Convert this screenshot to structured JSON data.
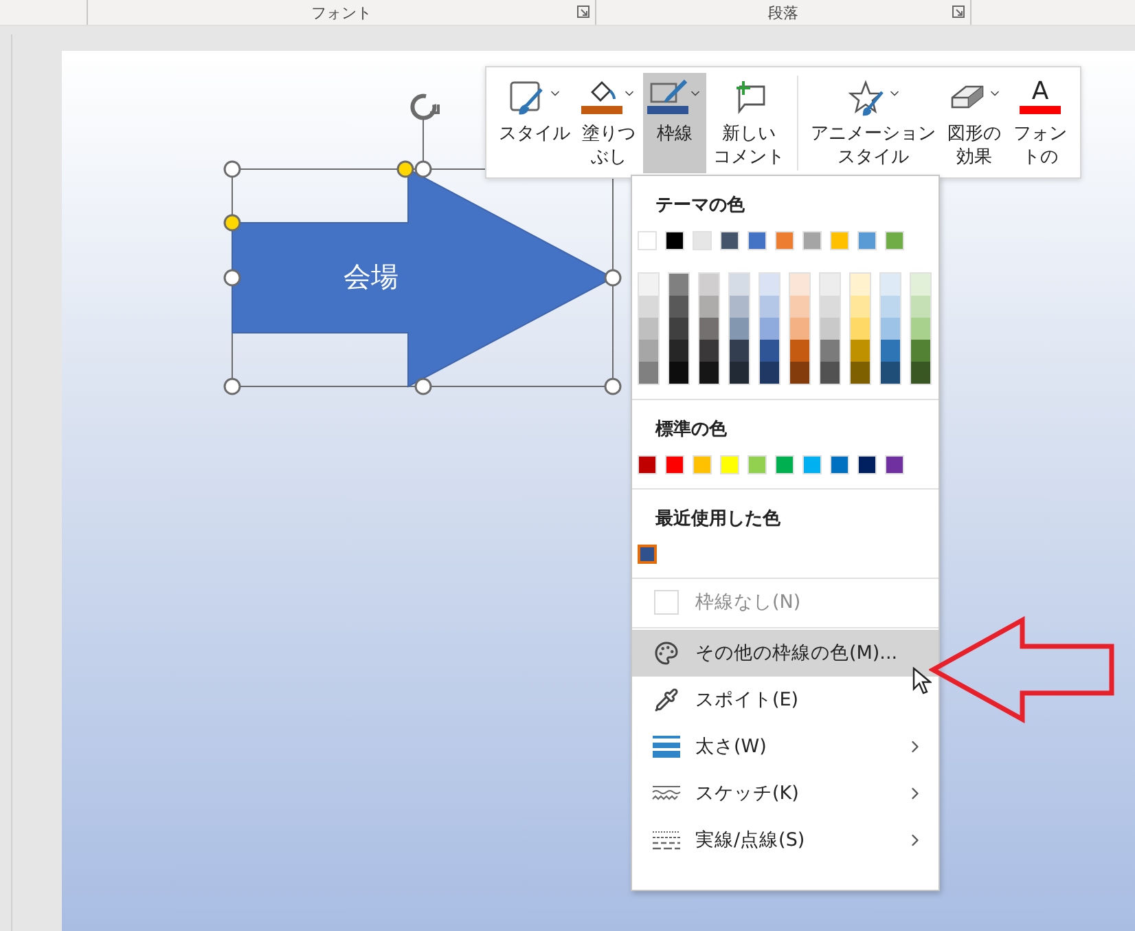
{
  "ribbon": {
    "groups": [
      {
        "label": "フォント"
      },
      {
        "label": "段落"
      }
    ]
  },
  "slide": {
    "shape": {
      "text": "会場"
    }
  },
  "mini_toolbar": {
    "buttons": [
      {
        "kind": "style",
        "lines": [
          "スタイル"
        ],
        "dropdown": true,
        "selected": false
      },
      {
        "kind": "fill",
        "lines": [
          "塗りつ",
          "ぶし"
        ],
        "dropdown": true,
        "selected": false,
        "color": "#c55a11"
      },
      {
        "kind": "outline",
        "lines": [
          "枠線"
        ],
        "dropdown": true,
        "selected": true,
        "color": "#2f5597"
      },
      {
        "kind": "comment",
        "lines": [
          "新しい",
          "コメント"
        ],
        "dropdown": false,
        "selected": false
      },
      {
        "kind": "animation",
        "lines": [
          "アニメーション",
          "スタイル"
        ],
        "dropdown": true,
        "selected": false
      },
      {
        "kind": "effects",
        "lines": [
          "図形の",
          "効果"
        ],
        "dropdown": true,
        "selected": false
      },
      {
        "kind": "font-color",
        "glyph": "A",
        "lines": [
          "フォン",
          "トの"
        ],
        "dropdown": false,
        "selected": false,
        "color": "#ff0000"
      }
    ]
  },
  "menu": {
    "theme_colors": {
      "heading": "テーマの色",
      "top": [
        {
          "color": "#ffffff"
        },
        {
          "color": "#000000"
        },
        {
          "color": "#e7e6e6"
        },
        {
          "color": "#44546a"
        },
        {
          "color": "#4472c4"
        },
        {
          "color": "#ed7d31"
        },
        {
          "color": "#a5a5a5"
        },
        {
          "color": "#ffc000"
        },
        {
          "color": "#5b9bd5"
        },
        {
          "color": "#70ad47"
        }
      ],
      "shades": [
        [
          {
            "color": "#f2f2f2"
          },
          {
            "color": "#d9d9d9"
          },
          {
            "color": "#bfbfbf"
          },
          {
            "color": "#a6a6a6"
          },
          {
            "color": "#808080"
          }
        ],
        [
          {
            "color": "#808080"
          },
          {
            "color": "#595959"
          },
          {
            "color": "#404040"
          },
          {
            "color": "#262626"
          },
          {
            "color": "#0d0d0d"
          }
        ],
        [
          {
            "color": "#d0cece"
          },
          {
            "color": "#aeabab"
          },
          {
            "color": "#757070"
          },
          {
            "color": "#3a3838"
          },
          {
            "color": "#171616"
          }
        ],
        [
          {
            "color": "#d6dce5"
          },
          {
            "color": "#adb9ca"
          },
          {
            "color": "#8497b0"
          },
          {
            "color": "#333f50"
          },
          {
            "color": "#222a35"
          }
        ],
        [
          {
            "color": "#dae3f3"
          },
          {
            "color": "#b4c7e7"
          },
          {
            "color": "#8faadc"
          },
          {
            "color": "#2f5597"
          },
          {
            "color": "#203864"
          }
        ],
        [
          {
            "color": "#fbe5d6"
          },
          {
            "color": "#f8cbad"
          },
          {
            "color": "#f4b183"
          },
          {
            "color": "#c55a11"
          },
          {
            "color": "#843c0c"
          }
        ],
        [
          {
            "color": "#ededed"
          },
          {
            "color": "#dbdbdb"
          },
          {
            "color": "#c9c9c9"
          },
          {
            "color": "#7b7b7b"
          },
          {
            "color": "#525252"
          }
        ],
        [
          {
            "color": "#fff2cc"
          },
          {
            "color": "#ffe699"
          },
          {
            "color": "#ffd966"
          },
          {
            "color": "#bf9000"
          },
          {
            "color": "#7f6000"
          }
        ],
        [
          {
            "color": "#deebf7"
          },
          {
            "color": "#bdd7ee"
          },
          {
            "color": "#9dc3e6"
          },
          {
            "color": "#2e75b6"
          },
          {
            "color": "#1f4e79"
          }
        ],
        [
          {
            "color": "#e2f0d9"
          },
          {
            "color": "#c5e0b4"
          },
          {
            "color": "#a9d18e"
          },
          {
            "color": "#548235"
          },
          {
            "color": "#385723"
          }
        ]
      ]
    },
    "standard_colors": {
      "heading": "標準の色",
      "colors": [
        {
          "color": "#c00000"
        },
        {
          "color": "#ff0000"
        },
        {
          "color": "#ffc000"
        },
        {
          "color": "#ffff00"
        },
        {
          "color": "#92d050"
        },
        {
          "color": "#00b050"
        },
        {
          "color": "#00b0f0"
        },
        {
          "color": "#0070c0"
        },
        {
          "color": "#002060"
        },
        {
          "color": "#7030a0"
        }
      ]
    },
    "recent_colors": {
      "heading": "最近使用した色",
      "colors": [
        {
          "color": "#2f528f",
          "selected": true
        }
      ]
    },
    "items": [
      {
        "kind": "no-outline",
        "label": "枠線なし(N)",
        "disabled": true,
        "selected": false,
        "submenu": false
      },
      {
        "kind": "palette",
        "label": "その他の枠線の色(M)...",
        "disabled": false,
        "selected": true,
        "submenu": false
      },
      {
        "kind": "eyedropper",
        "label": "スポイト(E)",
        "disabled": false,
        "selected": false,
        "submenu": false
      },
      {
        "kind": "weight",
        "label": "太さ(W)",
        "disabled": false,
        "selected": false,
        "submenu": true
      },
      {
        "kind": "sketch",
        "label": "スケッチ(K)",
        "disabled": false,
        "selected": false,
        "submenu": true
      },
      {
        "kind": "dash",
        "label": "実線/点線(S)",
        "disabled": false,
        "selected": false,
        "submenu": true
      }
    ]
  }
}
